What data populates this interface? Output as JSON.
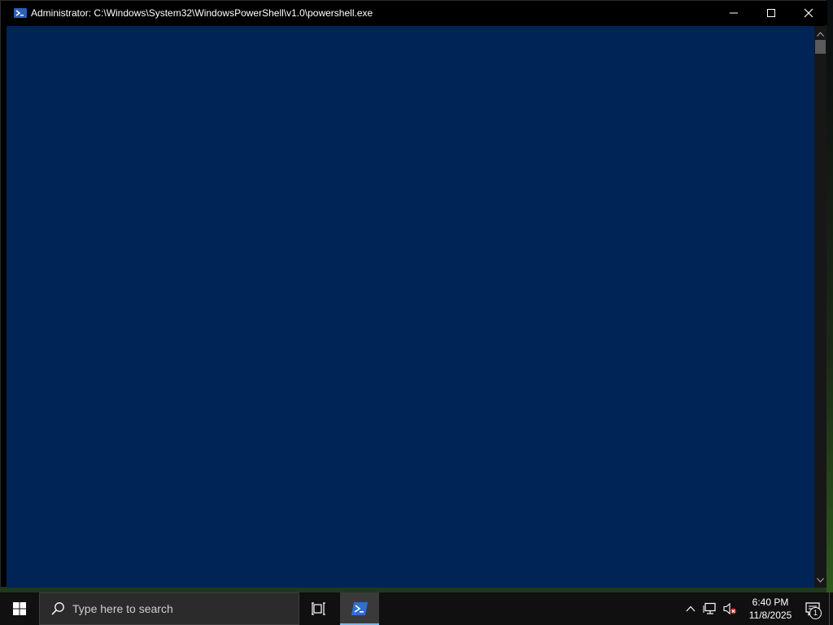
{
  "window": {
    "title": "Administrator: C:\\Windows\\System32\\WindowsPowerShell\\v1.0\\powershell.exe",
    "icon": "powershell-icon",
    "console_background": "#012456",
    "caption": {
      "minimize_icon": "minimize-icon",
      "maximize_icon": "maximize-icon",
      "close_icon": "close-icon"
    }
  },
  "taskbar": {
    "start_icon": "windows-logo-icon",
    "search": {
      "placeholder": "Type here to search",
      "icon": "search-icon"
    },
    "task_view_icon": "task-view-icon",
    "pinned_apps": [
      {
        "name": "Windows PowerShell",
        "icon": "powershell-icon",
        "active": true
      }
    ],
    "tray": {
      "chevron_icon": "chevron-up-icon",
      "network_icon": "network-icon",
      "volume_icon": "volume-muted-icon",
      "time": "6:40 PM",
      "date": "11/8/2025",
      "notifications_icon": "action-center-icon",
      "notification_count": "1"
    },
    "accent_color": "#76b9ed"
  }
}
